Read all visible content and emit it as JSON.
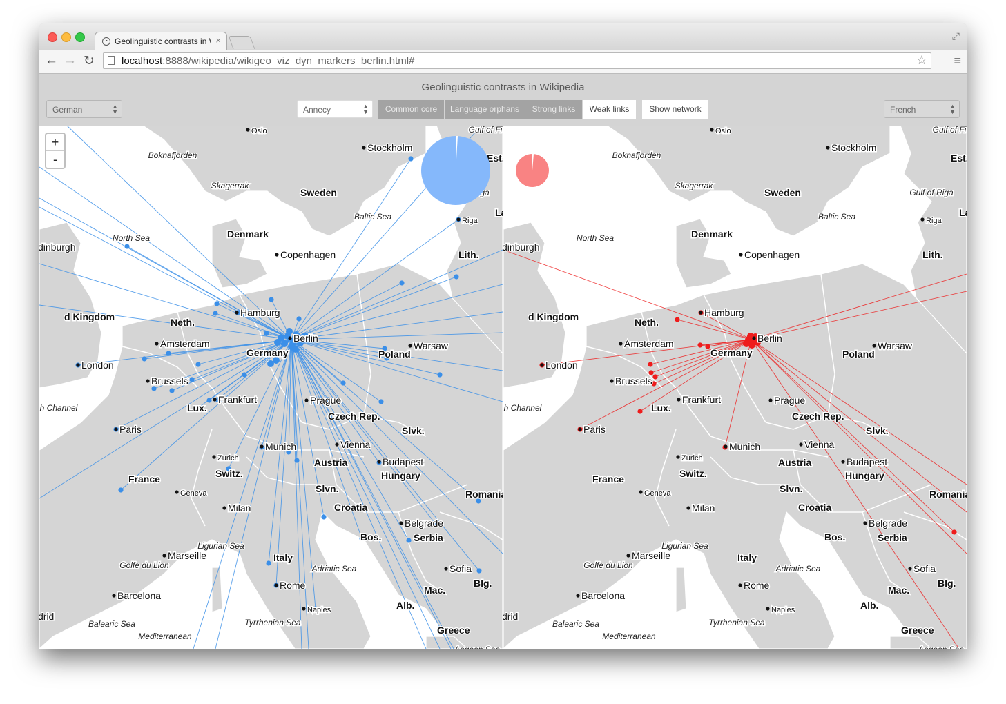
{
  "browser": {
    "tab_title": "Geolinguistic contrasts in W",
    "tab_close": "×",
    "tab_favicon": "github-icon",
    "url_host": "localhost",
    "url_rest": ":8888/wikipedia/wikigeo_viz_dyn_markers_berlin.html#",
    "icons": {
      "back": "←",
      "forward": "→",
      "reload": "↻",
      "star": "☆",
      "menu": "≡",
      "fullscreen": "⤢"
    }
  },
  "page": {
    "title": "Geolinguistic contrasts in Wikipedia",
    "left_language": "German",
    "right_language": "French",
    "city_select": "Annecy",
    "buttons": {
      "common_core": "Common core",
      "language_orphans": "Language orphans",
      "strong_links": "Strong links",
      "weak_links": "Weak links",
      "show_network": "Show network"
    },
    "zoom": {
      "in": "+",
      "out": "-"
    }
  },
  "map": {
    "base_colors": {
      "sea": "#ffffff",
      "land": "#d5d5d5",
      "border": "#ffffff"
    },
    "left_color": "#3b8fe8",
    "right_color": "#ee1c1c",
    "left_pie_color": "#85b8fb",
    "right_pie_color": "#f98383",
    "labels": [
      {
        "t": "Oslo",
        "k": "city"
      },
      {
        "t": "Stockholm",
        "k": "city"
      },
      {
        "t": "Riga",
        "k": "city"
      },
      {
        "t": "Copenhagen",
        "k": "city"
      },
      {
        "t": "Hamburg",
        "k": "city"
      },
      {
        "t": "Berlin",
        "k": "city"
      },
      {
        "t": "Amsterdam",
        "k": "city"
      },
      {
        "t": "London",
        "k": "city"
      },
      {
        "t": "Brussels",
        "k": "city"
      },
      {
        "t": "Frankfurt",
        "k": "city"
      },
      {
        "t": "Prague",
        "k": "city"
      },
      {
        "t": "Warsaw",
        "k": "city"
      },
      {
        "t": "Paris",
        "k": "city"
      },
      {
        "t": "Munich",
        "k": "city"
      },
      {
        "t": "Vienna",
        "k": "city"
      },
      {
        "t": "Zurich",
        "k": "city"
      },
      {
        "t": "Budapest",
        "k": "city"
      },
      {
        "t": "Geneva",
        "k": "city"
      },
      {
        "t": "Milan",
        "k": "city"
      },
      {
        "t": "Belgrade",
        "k": "city"
      },
      {
        "t": "Marseille",
        "k": "city"
      },
      {
        "t": "Sofia",
        "k": "city"
      },
      {
        "t": "Rome",
        "k": "city"
      },
      {
        "t": "Barcelona",
        "k": "city"
      },
      {
        "t": "Naples",
        "k": "city"
      },
      {
        "t": "Sweden",
        "k": "country"
      },
      {
        "t": "Denmark",
        "k": "country"
      },
      {
        "t": "Lith.",
        "k": "country"
      },
      {
        "t": "Neth.",
        "k": "country"
      },
      {
        "t": "Germany",
        "k": "country"
      },
      {
        "t": "Poland",
        "k": "country"
      },
      {
        "t": "Lux.",
        "k": "country"
      },
      {
        "t": "Czech Rep.",
        "k": "country"
      },
      {
        "t": "Slvk.",
        "k": "country"
      },
      {
        "t": "France",
        "k": "country"
      },
      {
        "t": "Switz.",
        "k": "country"
      },
      {
        "t": "Austria",
        "k": "country"
      },
      {
        "t": "Hungary",
        "k": "country"
      },
      {
        "t": "Slvn.",
        "k": "country"
      },
      {
        "t": "Croatia",
        "k": "country"
      },
      {
        "t": "Romania",
        "k": "country"
      },
      {
        "t": "Bos.",
        "k": "country"
      },
      {
        "t": "Serbia",
        "k": "country"
      },
      {
        "t": "Italy",
        "k": "country"
      },
      {
        "t": "Mac.",
        "k": "country"
      },
      {
        "t": "Blg.",
        "k": "country"
      },
      {
        "t": "Alb.",
        "k": "country"
      },
      {
        "t": "Greece",
        "k": "country"
      },
      {
        "t": "Est.",
        "k": "country"
      },
      {
        "t": "Lat",
        "k": "country"
      },
      {
        "t": "United Kingdom",
        "k": "country"
      },
      {
        "t": "Skagerrak",
        "k": "sea"
      },
      {
        "t": "Boknafjorden",
        "k": "sea"
      },
      {
        "t": "Gulf of Finland",
        "k": "sea"
      },
      {
        "t": "Gulf of Riga",
        "k": "sea"
      },
      {
        "t": "Baltic Sea",
        "k": "sea"
      },
      {
        "t": "North Sea",
        "k": "sea"
      },
      {
        "t": "English Channel",
        "k": "sea"
      },
      {
        "t": "Ligurian Sea",
        "k": "sea"
      },
      {
        "t": "Golfe du Lion",
        "k": "sea"
      },
      {
        "t": "Adriatic Sea",
        "k": "sea"
      },
      {
        "t": "Tyrrhenian Sea",
        "k": "sea"
      },
      {
        "t": "Balearic Sea",
        "k": "sea"
      },
      {
        "t": "Mediterranean Sea",
        "k": "sea"
      },
      {
        "t": "Aegean Sea",
        "k": "sea"
      },
      {
        "t": "Edinburgh",
        "k": "city"
      },
      {
        "t": "Madrid",
        "k": "city"
      }
    ]
  }
}
